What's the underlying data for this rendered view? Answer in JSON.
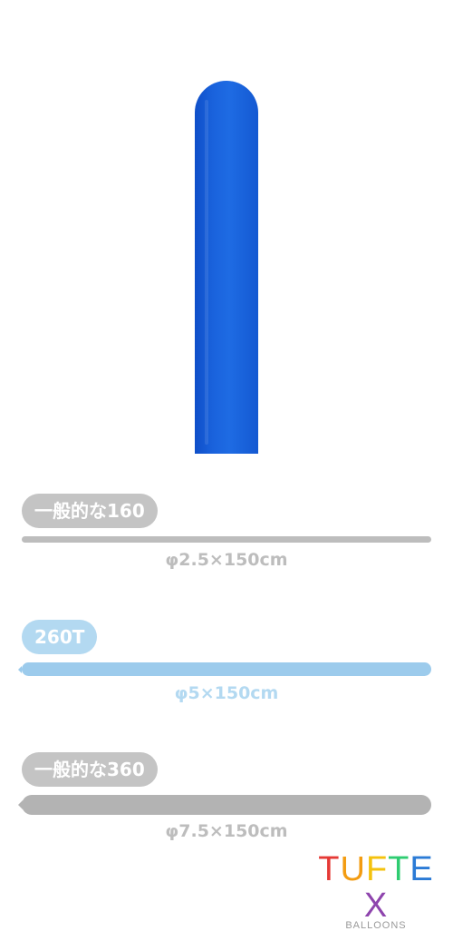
{
  "product": {
    "balloon_color": "#1a63dd"
  },
  "sizes": [
    {
      "label": "一般的な160",
      "dimension": "φ2.5×150cm",
      "color": "#bdbdbd",
      "highlight": false
    },
    {
      "label": "260T",
      "dimension": "φ5×150cm",
      "color": "#9ccbec",
      "highlight": true
    },
    {
      "label": "一般的な360",
      "dimension": "φ7.5×150cm",
      "color": "#b3b3b3",
      "highlight": false
    }
  ],
  "brand": {
    "name_letters": [
      "T",
      "U",
      "F",
      "T",
      "E",
      "X"
    ],
    "letter_colors": [
      "#e53935",
      "#f39c12",
      "#f4c20d",
      "#2ecc71",
      "#2b7bd6",
      "#8e44ad"
    ],
    "subtitle": "BALLOONS"
  }
}
